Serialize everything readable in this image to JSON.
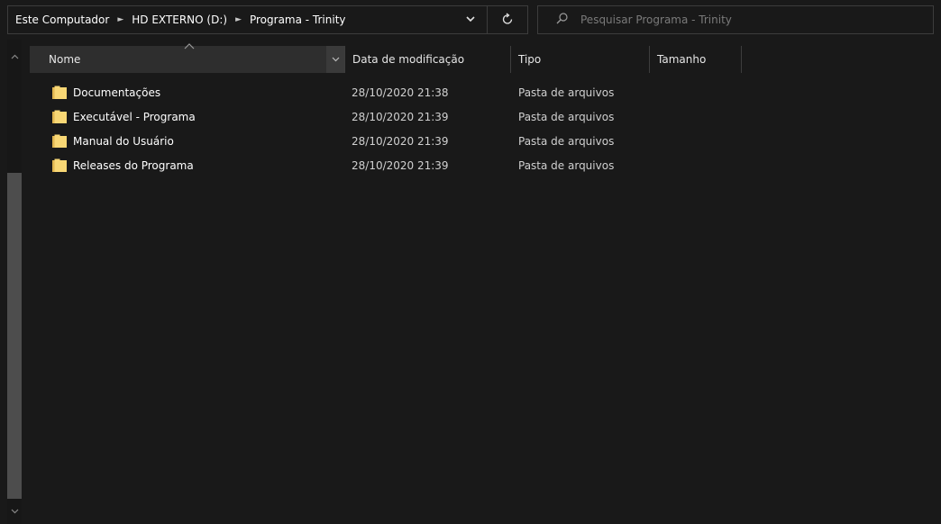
{
  "address": {
    "breadcrumbs": [
      "Este Computador",
      "HD EXTERNO (D:)",
      "Programa - Trinity"
    ],
    "dropdown_icon": "chevron-down-icon",
    "refresh_icon": "refresh-icon"
  },
  "search": {
    "placeholder": "Pesquisar Programa - Trinity",
    "icon": "search-icon"
  },
  "columns": {
    "name": "Nome",
    "date": "Data de modificação",
    "type": "Tipo",
    "size": "Tamanho",
    "sorted_by": "name"
  },
  "files": [
    {
      "name": "Documentações",
      "modified": "28/10/2020 21:38",
      "type": "Pasta de arquivos",
      "size": ""
    },
    {
      "name": "Executável - Programa",
      "modified": "28/10/2020 21:39",
      "type": "Pasta de arquivos",
      "size": ""
    },
    {
      "name": "Manual do Usuário",
      "modified": "28/10/2020 21:39",
      "type": "Pasta de arquivos",
      "size": ""
    },
    {
      "name": "Releases do Programa",
      "modified": "28/10/2020 21:39",
      "type": "Pasta de arquivos",
      "size": ""
    }
  ],
  "colors": {
    "background": "#191919",
    "header_active": "#2e2e2e",
    "folder": "#f8d775",
    "text": "#ffffff",
    "border": "#3c3c3c"
  }
}
